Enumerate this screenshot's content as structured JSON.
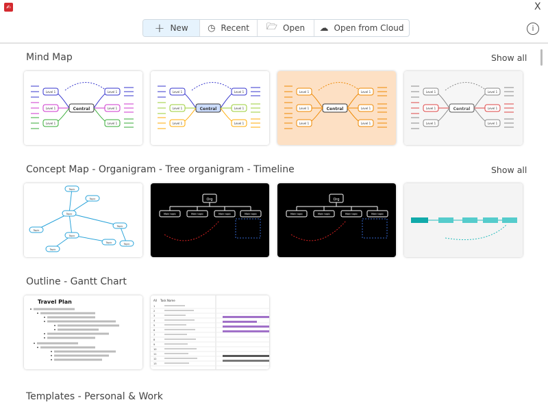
{
  "window": {
    "close_label": "X"
  },
  "toolbar": {
    "new": "New",
    "recent": "Recent",
    "open": "Open",
    "cloud": "Open from Cloud",
    "info": "i"
  },
  "sections": [
    {
      "title": "Mind Map",
      "show_all": "Show all"
    },
    {
      "title": "Concept Map - Organigram - Tree organigram - Timeline",
      "show_all": "Show all"
    },
    {
      "title": "Outline - Gantt Chart"
    },
    {
      "title": "Templates - Personal & Work"
    }
  ],
  "thumb_text": {
    "central": "Central",
    "level1": "Level 1",
    "org": "Org",
    "main_topic": "Main topic",
    "topic": "Topic",
    "travel_plan": "Travel Plan",
    "task_name": "Task Name",
    "all": "All"
  },
  "colors": {
    "accent_active": "#e6f3fd",
    "orange_bg": "#fde0c4",
    "dark_bg": "#000000"
  }
}
